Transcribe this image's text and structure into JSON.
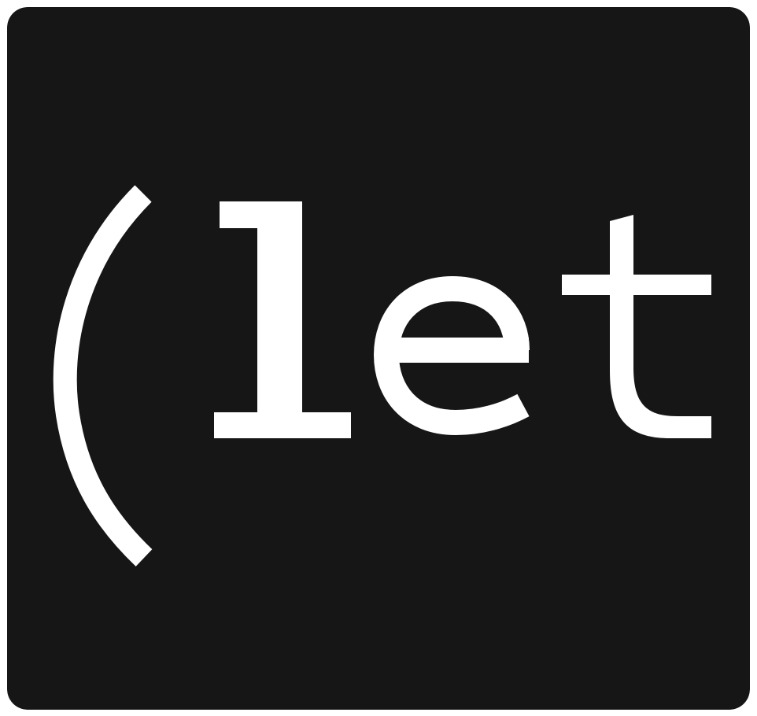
{
  "logo": {
    "text": "(let",
    "background_color": "#161616",
    "text_color": "#ffffff"
  }
}
